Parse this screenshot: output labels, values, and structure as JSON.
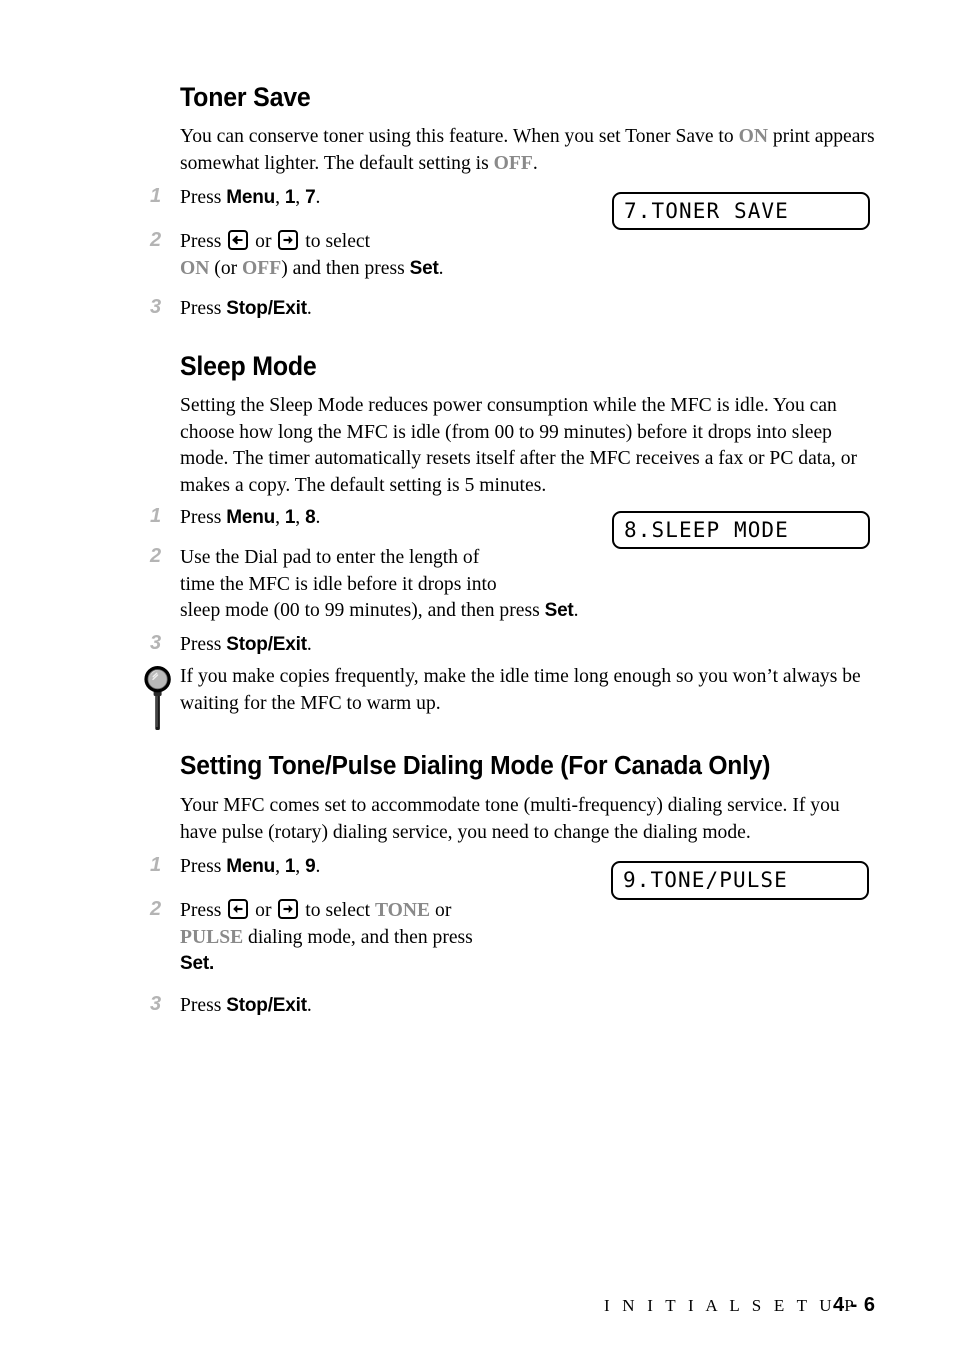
{
  "document": {
    "footer_section": "I N I T I A L   S E T U P",
    "footer_page": "4 - 6"
  },
  "sections": [
    {
      "heading": "Toner Save",
      "intro_a": "You can conserve toner using this feature. When you set Toner Save to ",
      "intro_on": "ON",
      "intro_b": " print appears somewhat lighter. The default setting is ",
      "intro_off": "OFF",
      "intro_c": ".",
      "steps": [
        {
          "num": "1",
          "text_a": "Press ",
          "bold1": "Menu",
          "sep1": ", ",
          "bold2": "1",
          "sep2": ", ",
          "bold3": "7",
          "tail": "."
        },
        {
          "num": "2",
          "line1_a": "Press ",
          "line1_b": " or ",
          "line1_c": " to select",
          "line2_on": "ON",
          "line2_mid": " (or ",
          "line2_off": "OFF",
          "line2_tail_a": ") and then press ",
          "line2_bold": "Set",
          "line2_tail_b": "."
        },
        {
          "num": "3",
          "text_a": "Press ",
          "bold1": "Stop/Exit",
          "tail": "."
        }
      ],
      "lcd": "7.TONER SAVE"
    },
    {
      "heading": "Sleep Mode",
      "intro": "Setting the Sleep Mode reduces power consumption while the MFC is idle.  You can choose how long the MFC is idle (from 00 to 99 minutes) before it drops into sleep mode.  The timer automatically resets itself after the MFC receives a fax or PC data, or makes a copy. The default setting is 5 minutes.",
      "steps": [
        {
          "num": "1",
          "text_a": "Press ",
          "bold1": "Menu",
          "sep1": ", ",
          "bold2": "1",
          "sep2": ", ",
          "bold3": "8",
          "tail": "."
        },
        {
          "num": "2",
          "line1": "Use the Dial pad to enter the length of",
          "line2": "time the MFC is idle before it drops into",
          "line3_a": "sleep mode (00 to 99 minutes), and then press ",
          "line3_bold": "Set",
          "line3_tail": "."
        },
        {
          "num": "3",
          "text_a": "Press ",
          "bold1": "Stop/Exit",
          "tail": "."
        }
      ],
      "lcd": "8.SLEEP MODE",
      "note": "If you make copies frequently, make the idle time long enough so you won’t always be waiting for the MFC to warm up.",
      "note_icon": "magnifier-icon"
    },
    {
      "heading": "Setting Tone/Pulse Dialing Mode (For Canada Only)",
      "intro": "Your MFC comes set to accommodate tone (multi-frequency) dialing service. If you have pulse (rotary) dialing service, you need to change the dialing mode.",
      "steps": [
        {
          "num": "1",
          "text_a": "Press ",
          "bold1": "Menu",
          "sep1": ", ",
          "bold2": "1",
          "sep2": ", ",
          "bold3": "9",
          "tail": "."
        },
        {
          "num": "2",
          "line1_a": "Press ",
          "line1_b": " or ",
          "line1_c": " to select ",
          "line1_tone": "TONE",
          "line1_or": " or",
          "line2_pulse": "PULSE",
          "line2_tail": " dialing mode, and then press",
          "line3_bold": "Set."
        },
        {
          "num": "3",
          "text_a": "Press ",
          "bold1": "Stop/Exit",
          "tail": "."
        }
      ],
      "lcd": "9.TONE/PULSE"
    }
  ],
  "icons": {
    "left_arrow_key": "arrow-left-key-icon",
    "right_arrow_key": "arrow-right-key-icon"
  },
  "colors": {
    "step_number": "#b4b4b4",
    "emphasis_gray": "#8a8a8a",
    "text": "#000000",
    "background": "#ffffff"
  }
}
